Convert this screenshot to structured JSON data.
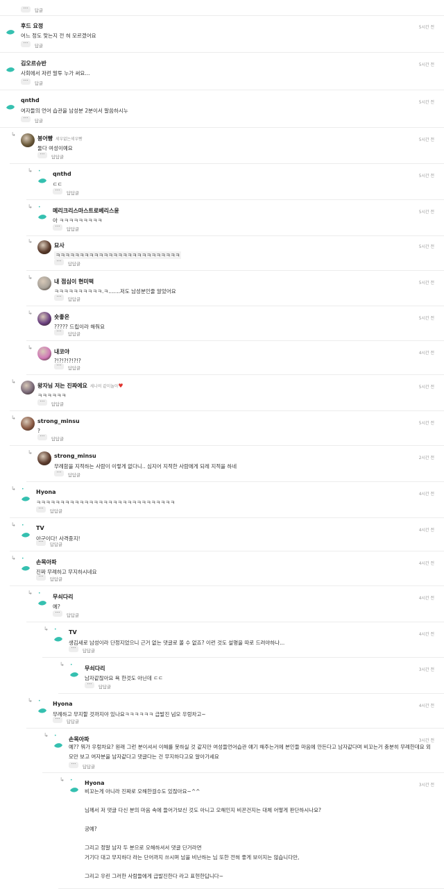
{
  "reply_label": "답글",
  "nested_reply_label": "답답글",
  "top_fragment": "......................",
  "comments": [
    {
      "name": "후드 요정",
      "text": "어느 정도 맞는지 전 혀 모르겠어요",
      "time": "5시간 전"
    },
    {
      "name": "김오르슈반",
      "text": "사회에서 저런 말투 누가 써요...",
      "time": "5시간 전"
    },
    {
      "name": "qnthd",
      "text": "여자들의 언어 습관을 남성분 2분이서 말씀하시누",
      "time": "5시간 전"
    },
    {
      "name": "붕어빵",
      "badge": "세우없는세우빵",
      "text": "둘다 여성이예요",
      "time": "5시간 전"
    },
    {
      "name": "qnthd",
      "text": "ㄷㄷ",
      "time": "5시간 전"
    },
    {
      "name": "메리크리스마스트로베리스윤",
      "text": "아 ㅋㅋㅋㅋㅋㅋㅋㅋㅋ",
      "time": "5시간 전"
    },
    {
      "name": "묘사",
      "text": "ㅋㅋㅋㅋㅋㅋㅋㅋㅋㅋㅋㅋㅋㅋㅋㅋㅋㅋㅋㅋㅋㅋㅋㅋㅋㅋ",
      "time": "5시간 전"
    },
    {
      "name": "내 점심이 현미떡",
      "text": "ㅋㅋㅋㅋㅋㅋㅋㅋㅋㅋ.ㅋ.......저도 남성분인줄 알았어요",
      "time": "5시간 전"
    },
    {
      "name": "숏좋온",
      "text": "????? 드립이라 해줘요",
      "time": "5시간 전"
    },
    {
      "name": "내코야",
      "text": "?!?!?!?!?!?",
      "time": "4시간 전"
    },
    {
      "name": "왕자님 저는 진짜에요",
      "badge": "세나의 같이놀아",
      "text": "ㅋㅋㅋㅋㅋㅋ",
      "time": "5시간 전"
    },
    {
      "name": "strong_minsu",
      "text": "?",
      "time": "5시간 전"
    },
    {
      "name": "strong_minsu",
      "text": "무례함을 지적하는 사람이 이렇게 없다니.. 심지어 지적한 사람에게 되레 지적을 하네",
      "time": "2시간 전"
    },
    {
      "name": "Hyona",
      "text": "ㅋㅋㅋㅋㅋㅋㅋㅋㅋㅋㅋㅋㅋㅋㅋㅋㅋㅋㅋㅋㅋㅋㅋㅋㅋㅋㅋㅋㅋ",
      "time": "4시간 전"
    },
    {
      "name": "TV",
      "text": "아군이다! 사격중지!",
      "time": "4시간 전"
    },
    {
      "name": "손목아파",
      "text": "진짜 무례하고 무지하시네요",
      "time": "4시간 전"
    },
    {
      "name": "무쇠다리",
      "text": "예?",
      "time": "4시간 전"
    },
    {
      "name": "TV",
      "text": "생김새로 남성이라 단정지었으니 근거 없는 댓글로 볼 수 없죠? 이런 것도 설명을 따로 드려야하나...",
      "time": "4시간 전"
    },
    {
      "name": "무쇠다리",
      "text": "남자같잖아요 욕 한것도 아닌데 ㄷㄷ",
      "time": "3시간 전"
    },
    {
      "name": "Hyona",
      "text": "무례하고 무지할 것까지야 있나요ㅋㅋㅋㅋㅋㅋ 급발진 넘모 우렁차고~",
      "time": "4시간 전"
    },
    {
      "name": "손목아파",
      "text_lines": [
        "예?? 뭐가 우렁차요? 원래 그런 분이셔서 이해를 못하실 것 같지만 여성들언어습관 얘기 해주는거에 본인들 마음에 안든다고 남자같다며 비꼬는거 충분히 무례한데요 외",
        "모만 보고 여자분을 남자같다고 댓글다는 건 무지하다고요 알아가세요"
      ],
      "time": "3시간 전"
    },
    {
      "name": "Hyona",
      "text_lines": [
        "비꼬는게 아니라 진짜로 오해한걸수도 있잖아요~^^",
        "",
        "님께서 저 댓글 다신 분의 마음 속에 들어가보신 것도 아니고 오해인지 비꼰건지는 대체 어떻게 판단하시나요?",
        "",
        "궁예?",
        "",
        "그리고 정말 남자 두 분으로 오해하셔서 댓글 단거라면",
        "거기다 대고 무지하다 라는 단어까지 쓰시며 남을 비난하는 님 또한 전혀 좋게 보이지는 않습니다만,",
        "",
        "그리고 우린 그러한 사람들에게 급발진한다 라고 표현한답니다~"
      ],
      "time": "3시간 전"
    }
  ],
  "colors": {
    "leaf": "#35c0b0",
    "divider": "#ececec",
    "heart": "#e0332e"
  }
}
